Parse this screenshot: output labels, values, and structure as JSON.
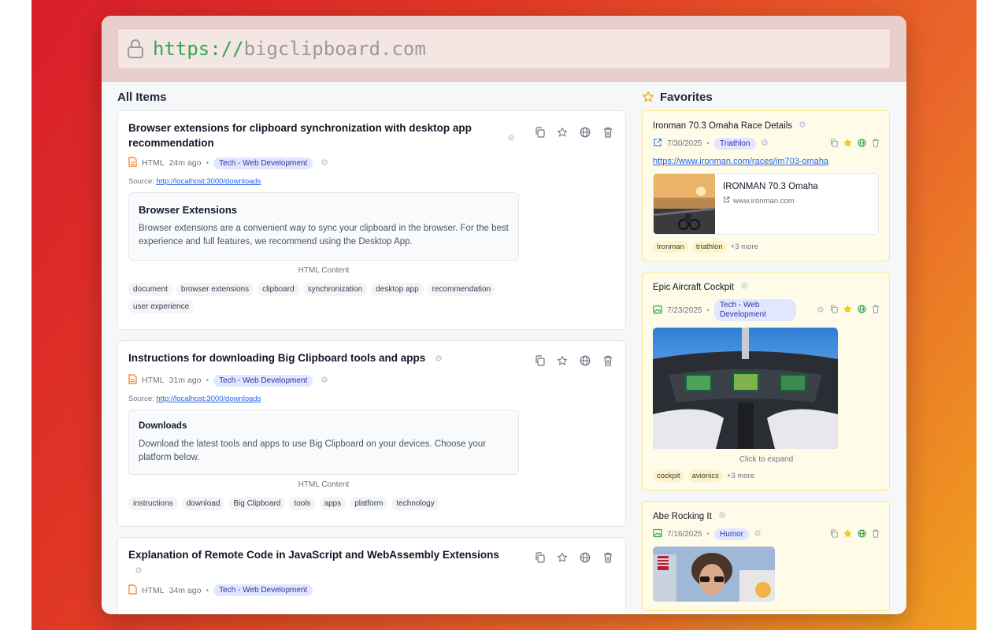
{
  "address_bar": {
    "scheme": "https://",
    "host": "bigclipboard.com"
  },
  "all_items": {
    "heading": "All Items",
    "items": [
      {
        "title": "Browser extensions for clipboard synchronization with desktop app recommendation",
        "type": "HTML",
        "time": "24m ago",
        "category": "Tech - Web Development",
        "source_label": "Source:",
        "source_url": "http://localhost:3000/downloads",
        "preview_title": "Browser Extensions",
        "preview_body": "Browser extensions are a convenient way to sync your clipboard in the browser. For the best experience and full features, we recommend using the Desktop App.",
        "preview_label": "HTML Content",
        "tags": [
          "document",
          "browser extensions",
          "clipboard",
          "synchronization",
          "desktop app",
          "recommendation",
          "user experience"
        ]
      },
      {
        "title": "Instructions for downloading Big Clipboard tools and apps",
        "type": "HTML",
        "time": "31m ago",
        "category": "Tech - Web Development",
        "source_label": "Source:",
        "source_url": "http://localhost:3000/downloads",
        "preview_title": "Downloads",
        "preview_body": "Download the latest tools and apps to use Big Clipboard on your devices. Choose your platform below.",
        "preview_label": "HTML Content",
        "tags": [
          "instructions",
          "download",
          "Big Clipboard",
          "tools",
          "apps",
          "platform",
          "technology"
        ]
      },
      {
        "title": "Explanation of Remote Code in JavaScript and WebAssembly Extensions",
        "type": "HTML",
        "time": "34m ago",
        "category": "Tech - Web Development"
      }
    ]
  },
  "favorites": {
    "heading": "Favorites",
    "items": [
      {
        "title": "Ironman 70.3 Omaha Race Details",
        "date": "7/30/2025",
        "category": "Triathlon",
        "link": "https://www.ironman.com/races/im703-omaha",
        "og_title": "IRONMAN 70.3 Omaha",
        "og_site": "www.ironman.com",
        "tags": [
          "Ironman",
          "triathlon"
        ],
        "more": "+3 more"
      },
      {
        "title": "Epic Aircraft Cockpit",
        "date": "7/23/2025",
        "category": "Tech - Web Development",
        "expand_label": "Click to expand",
        "tags": [
          "cockpit",
          "avionics"
        ],
        "more": "+3 more"
      },
      {
        "title": "Abe Rocking It",
        "date": "7/16/2025",
        "category": "Humor"
      }
    ]
  },
  "colors": {
    "accent_star": "#e8b400",
    "link": "#2563eb",
    "url_scheme": "#2fa84f"
  }
}
